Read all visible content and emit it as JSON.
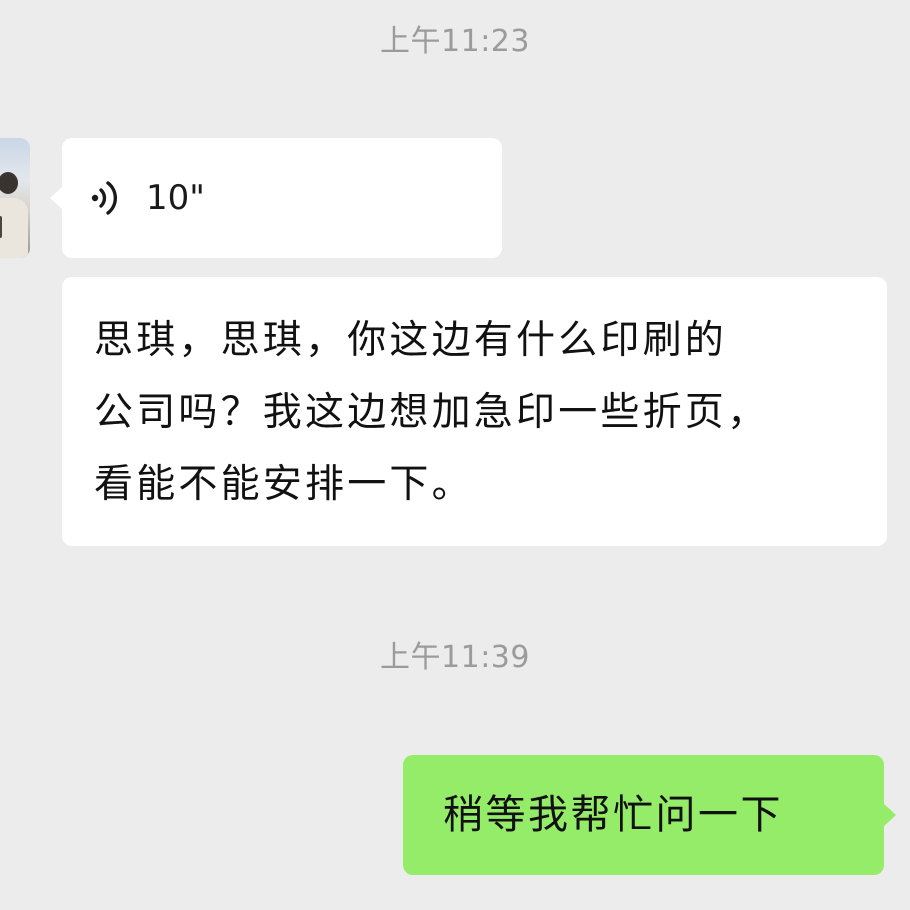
{
  "chat": {
    "timestamps": [
      "上午11:23",
      "上午11:39"
    ],
    "messages": [
      {
        "type": "voice",
        "direction": "incoming",
        "duration": "10\""
      },
      {
        "type": "text",
        "direction": "incoming",
        "text": "思琪，思琪，你这边有什么印刷的\n公司吗？我这边想加急印一些折页，\n看能不能安排一下。"
      },
      {
        "type": "text",
        "direction": "outgoing",
        "text": "稍等我帮忙问一下"
      }
    ]
  },
  "colors": {
    "background": "#ececec",
    "incoming_bubble": "#ffffff",
    "outgoing_bubble": "#95ec69",
    "timestamp": "#9b9b9b"
  },
  "icons": {
    "voice": "voice-wave-icon",
    "avatar": "contact-avatar"
  }
}
